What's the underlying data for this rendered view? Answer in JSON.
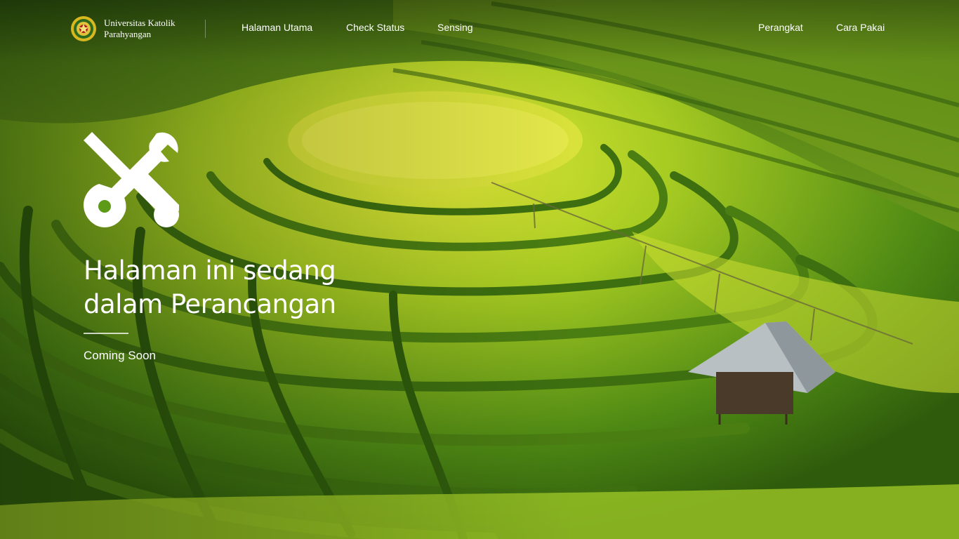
{
  "brand": {
    "line1": "Universitas Katolik",
    "line2": "Parahyangan",
    "logo_icon": "university-seal-icon"
  },
  "nav": {
    "links": [
      {
        "label": "Halaman Utama"
      },
      {
        "label": "Check Status"
      },
      {
        "label": "Sensing"
      },
      {
        "label": "Perangkat"
      },
      {
        "label": "Cara Pakai"
      }
    ]
  },
  "hero": {
    "icon": "tools-icon",
    "title_line1": "Halaman ini sedang",
    "title_line2": "dalam Perancangan",
    "subtitle": "Coming Soon"
  },
  "colors": {
    "text": "#ffffff",
    "field_green": "#5d9a18",
    "field_yellow": "#d8e02a"
  }
}
